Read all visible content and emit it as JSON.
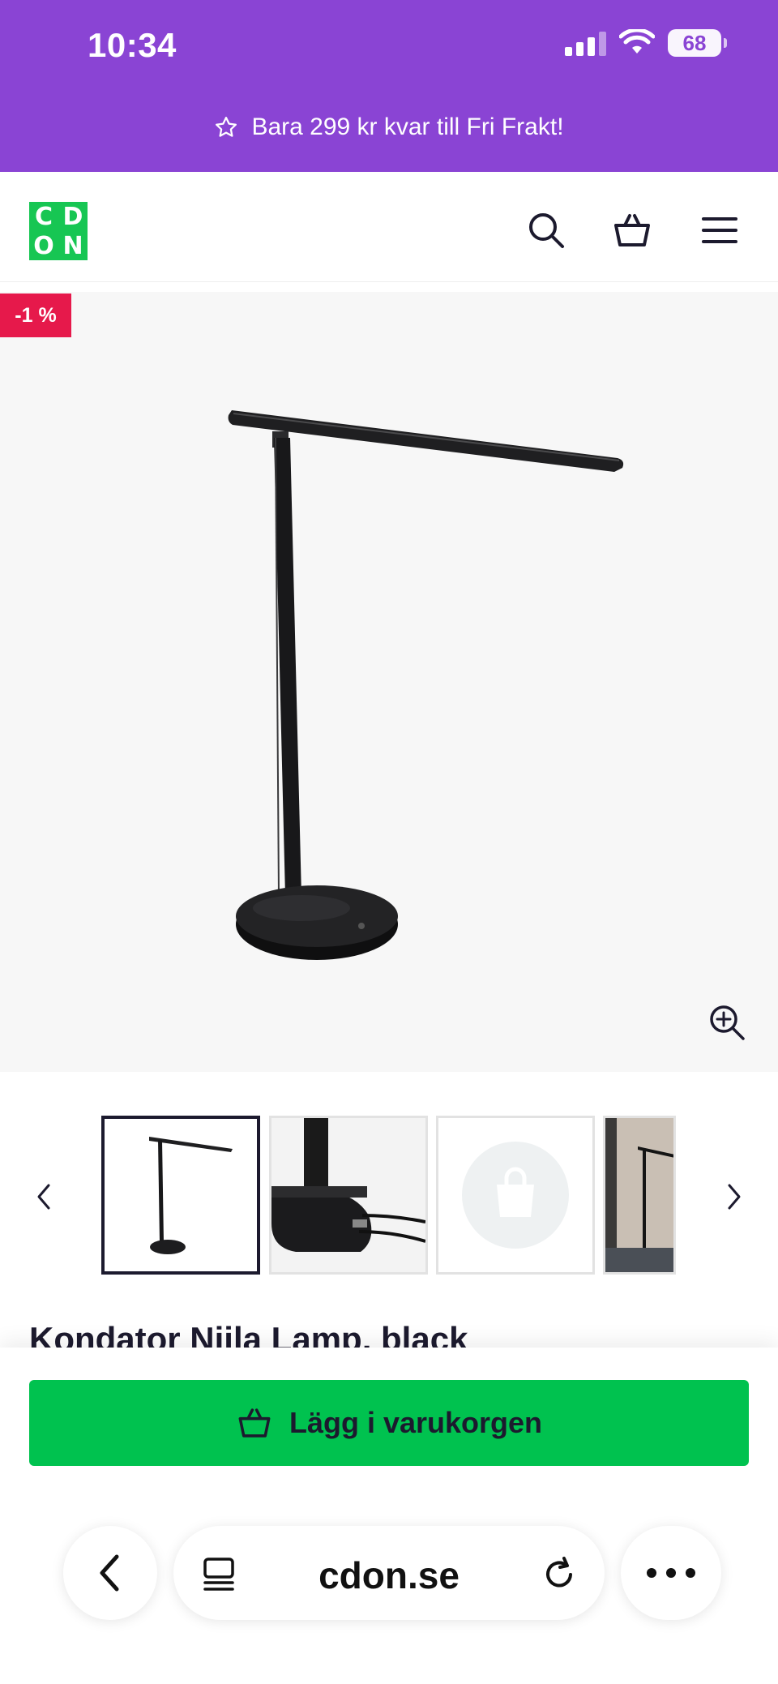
{
  "status_bar": {
    "time": "10:34",
    "battery": "68"
  },
  "promo": {
    "text": "Bara 299 kr kvar till Fri Frakt!",
    "icon": "star-outline-icon"
  },
  "header": {
    "logo_letters": [
      "C",
      "D",
      "O",
      "N"
    ],
    "icons": [
      "search-icon",
      "basket-icon",
      "menu-icon"
    ],
    "brand_color": "#17c653"
  },
  "product": {
    "discount_badge": "-1 %",
    "title": "Kondator Niila Lamp, black"
  },
  "gallery": {
    "thumbnails": [
      "lamp-front",
      "lamp-base-cable",
      "placeholder-bag",
      "lamp-room"
    ],
    "active_index": 0
  },
  "cta": {
    "add_to_cart_label": "Lägg i varukorgen",
    "color": "#00c24f"
  },
  "browser": {
    "domain": "cdon.se"
  },
  "theme": {
    "accent": "#8a44d4",
    "discount_color": "#e6194b"
  }
}
